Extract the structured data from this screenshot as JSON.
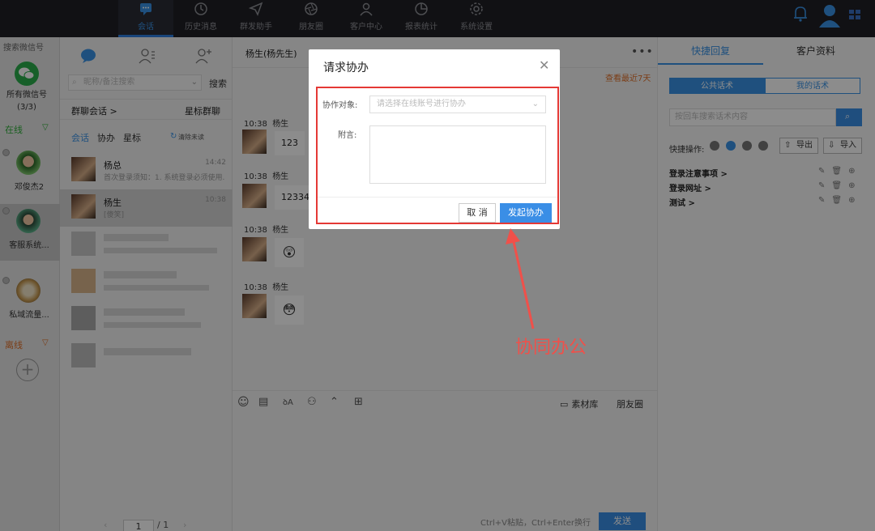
{
  "nav": {
    "items": [
      {
        "label": "会话",
        "icon": "chat-icon"
      },
      {
        "label": "历史消息",
        "icon": "clock-icon"
      },
      {
        "label": "群发助手",
        "icon": "paper-plane-icon"
      },
      {
        "label": "朋友圈",
        "icon": "aperture-icon"
      },
      {
        "label": "客户中心",
        "icon": "person-icon"
      },
      {
        "label": "报表统计",
        "icon": "pie-chart-icon"
      },
      {
        "label": "系统设置",
        "icon": "gear-icon"
      }
    ]
  },
  "accounts": {
    "search_label": "搜索微信号",
    "all_label": "所有微信号",
    "all_count": "(3/3)",
    "online_label": "在线",
    "offline_label": "离线",
    "items": [
      {
        "name": "邓俊杰2"
      },
      {
        "name": "客服系统..."
      },
      {
        "name": "私域流量..."
      }
    ]
  },
  "conversations": {
    "search_placeholder": "昵称/备注搜索",
    "search_btn": "搜索",
    "group_chat_label": "群聊会话 >",
    "star_group_label": "星标群聊",
    "tabs": [
      "会话",
      "协办",
      "星标"
    ],
    "clear_unread": "清除未读",
    "items": [
      {
        "name": "杨总",
        "time": "14:42",
        "msg": "首次登录须知：1. 系统登录必须使用..."
      },
      {
        "name": "杨生",
        "time": "10:38",
        "msg": "[傻笑]"
      }
    ],
    "pager": {
      "current": "1",
      "total": "/ 1"
    }
  },
  "chat": {
    "title": "杨生(杨先生)",
    "recent_link": "查看最近7天",
    "messages": [
      {
        "time": "10:38",
        "sender": "杨生",
        "text": "123"
      },
      {
        "time": "10:38",
        "sender": "杨生",
        "text": "12334"
      },
      {
        "time": "10:38",
        "sender": "杨生",
        "text": "😲"
      },
      {
        "time": "10:38",
        "sender": "杨生",
        "text": "😳"
      }
    ],
    "material_label": "素材库",
    "moments_label": "朋友圈",
    "paste_hint": "Ctrl+V粘贴，Ctrl+Enter换行",
    "send_label": "发送"
  },
  "right": {
    "tabs": [
      "快捷回复",
      "客户资料"
    ],
    "segments": [
      "公共话术",
      "我的话术"
    ],
    "search_placeholder": "按回车搜索话术内容",
    "quick_ops_label": "快捷操作:",
    "export_label": "导出",
    "import_label": "导入",
    "items": [
      "登录注意事项 >",
      "登录网址 >",
      "测试 >"
    ]
  },
  "dialog": {
    "title": "请求协办",
    "target_label": "协作对象:",
    "target_placeholder": "请选择在线账号进行协办",
    "note_label": "附言:",
    "cancel": "取 消",
    "submit": "发起协办"
  },
  "annotation": "协同办公",
  "colors": {
    "accent": "#3a8ee6",
    "highlight": "#e53935",
    "online": "#2fae3a",
    "offline": "#e0702a"
  }
}
